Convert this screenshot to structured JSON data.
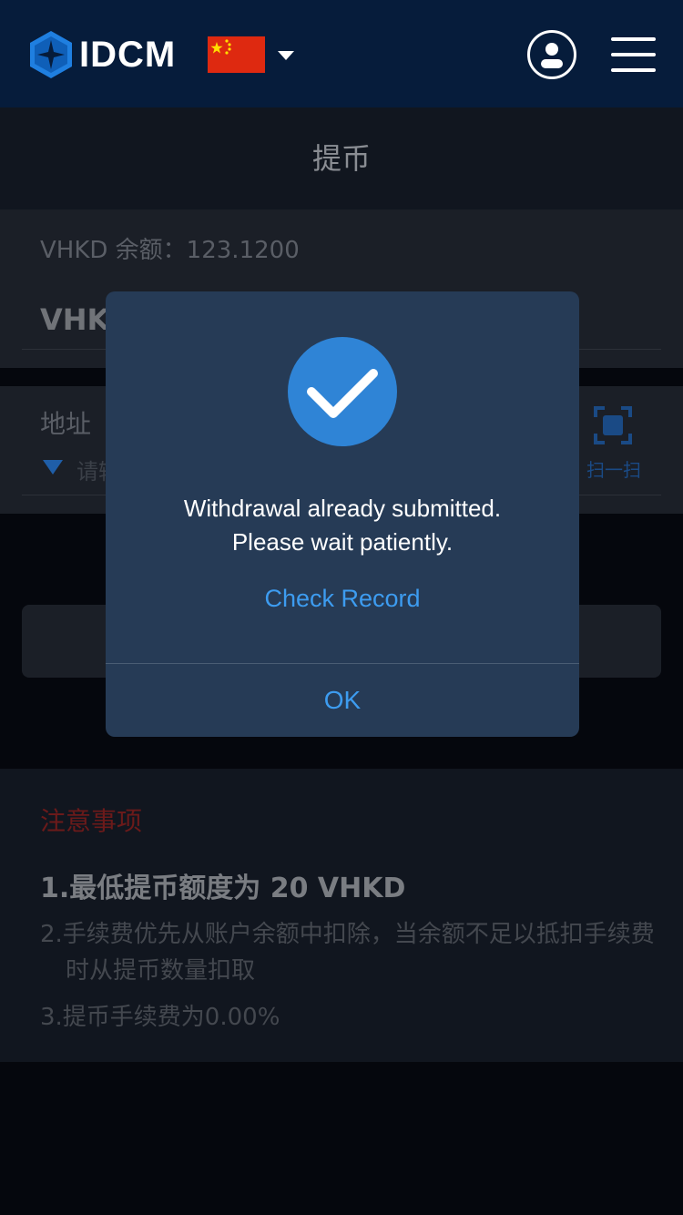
{
  "header": {
    "logo_text": "IDCM",
    "flag_icon": "china-flag-icon",
    "colors": {
      "background": "#061c3b",
      "flag": "#de2910"
    }
  },
  "page": {
    "title": "提币",
    "balance_text": "VHKD 余额：123.1200",
    "coin_value": "VHK",
    "address_label": "地址",
    "address_hint": "请输",
    "scan_label": "扫一扫"
  },
  "notes": {
    "title": "注意事项",
    "items": [
      "1.最低提币额度为 20 VHKD",
      "2.手续费优先从账户余额中扣除，当余额不足以抵扣手续费时从提币数量扣取",
      "3.提币手续费为0.00%"
    ]
  },
  "dialog": {
    "message_line1": "Withdrawal already submitted.",
    "message_line2": "Please wait patiently.",
    "link_label": "Check Record",
    "ok_label": "OK",
    "colors": {
      "background": "#263b56",
      "accent": "#3d9cf0",
      "check": "#2f84d6"
    }
  }
}
